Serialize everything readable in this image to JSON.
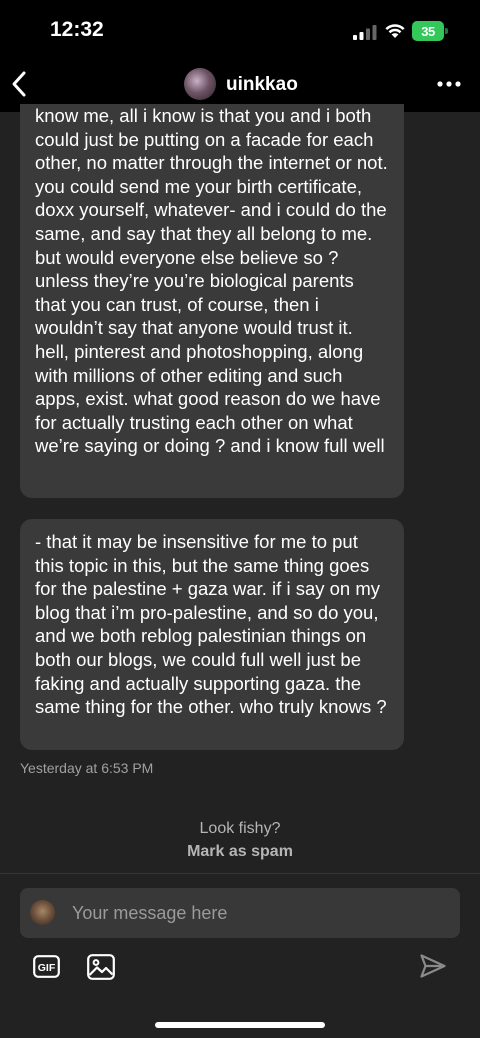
{
  "status_bar": {
    "time": "12:32",
    "battery": "35"
  },
  "header": {
    "username": "uinkkao"
  },
  "messages": [
    {
      "text": "know me, all i know is that you and i both could just be putting on a facade for each other, no matter through the internet or not. you could send me your birth certificate, doxx yourself, whatever- and i could do the same, and say that they all belong to me. but would everyone else believe so ? unless they’re you’re biological parents that you can trust, of course, then i wouldn’t say that anyone would trust it. hell, pinterest and photoshopping, along with millions of other editing and such apps, exist. what good reason do we have for actually trusting each other on what we’re saying or doing ? and i know full well"
    },
    {
      "text": "- that it may be insensitive for me to put this topic in this, but the same thing goes for the palestine + gaza war. if i say on my blog that i’m pro-palestine, and so do you, and we both reblog palestinian things on both our blogs, we could full well just be faking and actually supporting gaza. the same thing for the other. who truly knows ?"
    }
  ],
  "timestamp": "Yesterday at 6:53 PM",
  "spam": {
    "question": "Look fishy?",
    "link": "Mark as spam"
  },
  "composer": {
    "placeholder": "Your message here"
  },
  "icons": {
    "back": "chevron-left-icon",
    "more": "more-horizontal-icon",
    "gif": "gif-icon",
    "image": "image-icon",
    "send": "send-icon"
  },
  "colors": {
    "background": "#222222",
    "bubble": "#3a3a3a",
    "battery": "#34c759"
  }
}
